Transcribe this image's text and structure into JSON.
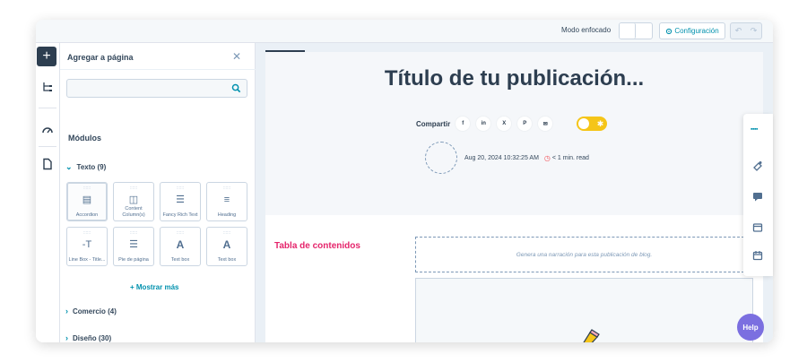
{
  "topbar": {
    "focus_mode_label": "Modo enfocado",
    "config_label": "Configuración",
    "undo_icon": "undo-icon",
    "redo_icon": "redo-icon"
  },
  "rail": {
    "icons": [
      "plus-icon",
      "structure-icon",
      "gauge-icon",
      "page-icon"
    ]
  },
  "panel": {
    "title": "Agregar a página",
    "close_icon": "close-icon",
    "search_placeholder": "",
    "section_label": "Módulos",
    "categories": [
      {
        "label": "Texto (9)",
        "expanded": true
      },
      {
        "label": "Comercio (4)",
        "expanded": false
      },
      {
        "label": "Diseño (30)",
        "expanded": false
      }
    ],
    "tiles": [
      {
        "label": "Accordion",
        "glyph": "▤"
      },
      {
        "label": "Content Column(s)",
        "glyph": "◫"
      },
      {
        "label": "Fancy Rich Text",
        "glyph": "☰"
      },
      {
        "label": "Heading",
        "glyph": "≡"
      },
      {
        "label": "Line Box - Title...",
        "glyph": "-T"
      },
      {
        "label": "Pie de página",
        "glyph": "☰"
      },
      {
        "label": "Text box",
        "glyph": "A"
      },
      {
        "label": "Text box",
        "glyph": "A"
      }
    ],
    "tile_grip": "::::::",
    "show_more": "+ Mostrar más"
  },
  "editor": {
    "title": "Título de tu publicación...",
    "share_label": "Compartir",
    "share_icons": [
      {
        "name": "facebook-icon",
        "glyph": "f"
      },
      {
        "name": "linkedin-icon",
        "glyph": "in"
      },
      {
        "name": "x-icon",
        "glyph": "X"
      },
      {
        "name": "pinterest-icon",
        "glyph": "P"
      },
      {
        "name": "email-icon",
        "glyph": "✉"
      }
    ],
    "date": "Aug 20, 2024 10:32:25 AM",
    "read_time": "< 1 min. read",
    "toc_title": "Tabla de contenidos",
    "narration_placeholder": "Genera una narración para esta publicación de blog."
  },
  "right_toolbar": {
    "icons": [
      "grip-icon",
      "paint-icon",
      "comment-icon",
      "layout-icon",
      "calendar-icon"
    ]
  },
  "help_label": "Help",
  "colors": {
    "accent": "#0091ae",
    "toc_pink": "#e5246b",
    "toggle_yellow": "#f5c518",
    "help_purple": "#7b6fe0",
    "dark": "#2d3e50"
  }
}
